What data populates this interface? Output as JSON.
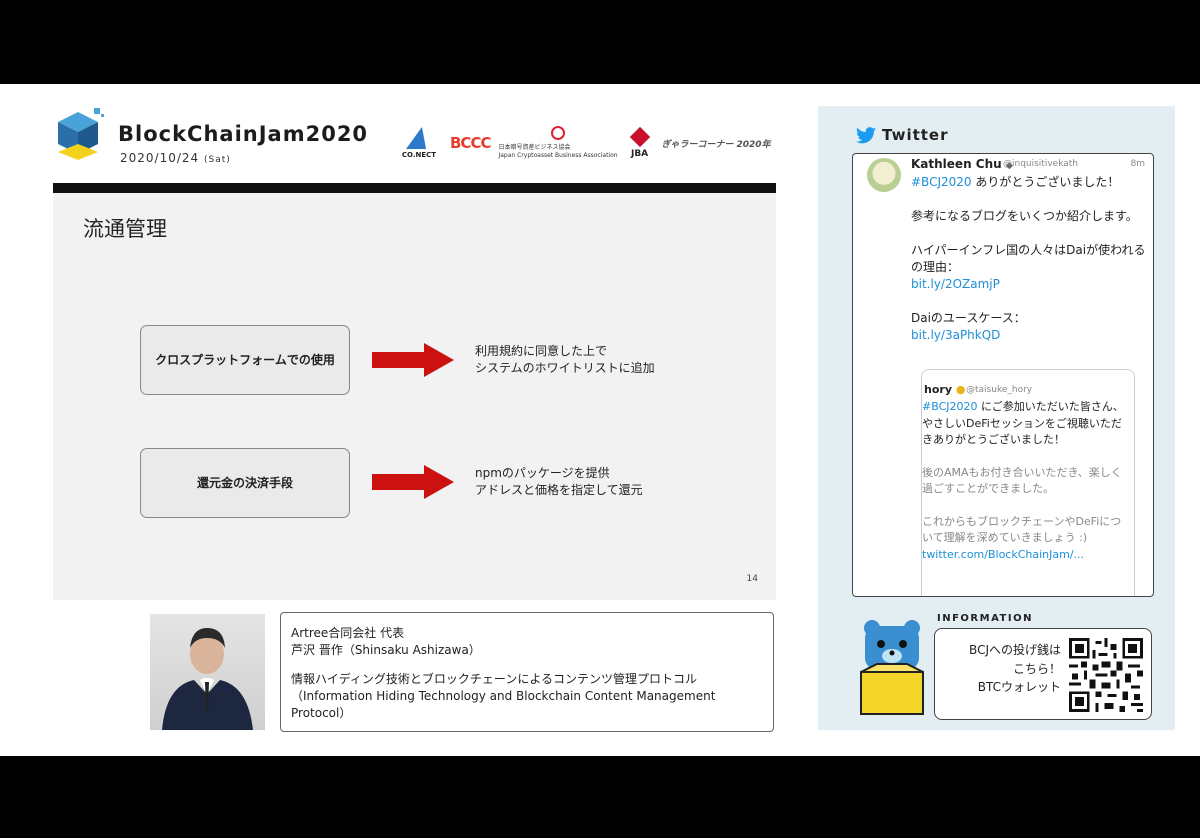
{
  "brand": {
    "title": "BlockChainJam2020",
    "date": "2020/10/24",
    "day": "(Sat)"
  },
  "sponsors": {
    "connect": "CO.NECT",
    "bcc": "BCCC",
    "jcba_line1": "日本暗号資産ビジネス協会",
    "jcba_line2": "Japan Cryptoasset Business Association",
    "jba": "JBA",
    "rl": "ぎゃラーコーナー 2020年"
  },
  "slide": {
    "title": "流通管理",
    "rows": [
      {
        "box": "クロスプラットフォームでの使用",
        "desc_line1": "利用規約に同意した上で",
        "desc_line2": "システムのホワイトリストに追加"
      },
      {
        "box": "還元金の決済手段",
        "desc_line1": "npmのパッケージを提供",
        "desc_line2": "アドレスと価格を指定して還元"
      }
    ],
    "page": "14"
  },
  "speaker": {
    "company": "Artree合同会社 代表",
    "name": "芦沢 晋作（Shinsaku Ashizawa）",
    "talk_ja": "情報ハイディング技術とブロックチェーンによるコンテンツ管理プロトコル",
    "talk_en": "（Information Hiding Technology and Blockchain Content Management Protocol）"
  },
  "twitter": {
    "header": "Twitter",
    "tweet": {
      "name": "Kathleen Chu",
      "handle": "@inquisitivekath",
      "time": "8m",
      "hashtag": "#BCJ2020",
      "line1": " ありがとうございました！",
      "line2": "参考になるブログをいくつか紹介します。",
      "line3": "ハイパーインフレ国の人々はDaiが使われるの理由：",
      "link1": "bit.ly/2OZamjP",
      "line4": "Daiのユースケース：",
      "link2": "bit.ly/3aPhkQD"
    },
    "quote": {
      "name": "hory",
      "handle": "@taisuke_hory",
      "hashtag": "#BCJ2020",
      "line1": " にご参加いただいた皆さん、やさしいDeFiセッションをご視聴いただきありがとうございました！",
      "line2": "後のAMAもお付き合いいただき、楽しく過ごすことができました。",
      "line3": "これからもブロックチェーンやDeFiについて理解を深めていきましょう :)",
      "link": "twitter.com/BlockChainJam/..."
    }
  },
  "information": {
    "label": "INFORMATION",
    "line1": "BCJへの投げ銭は",
    "line2": "こちら！",
    "line3": "BTCウォレット"
  },
  "colors": {
    "accent_arrow": "#cc1111",
    "twitter_blue": "#1d9bf0",
    "panel_bg": "#e2eef2"
  }
}
